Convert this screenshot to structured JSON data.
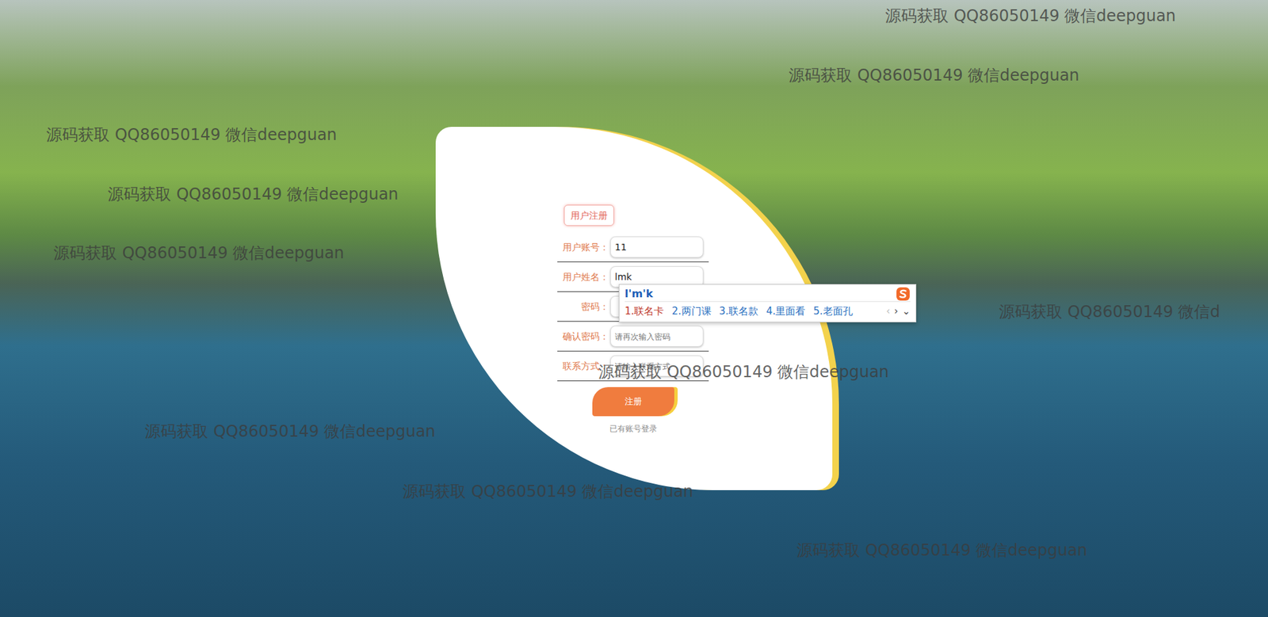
{
  "form": {
    "title": "用户注册",
    "fields": [
      {
        "label": "用户账号：",
        "value": "11"
      },
      {
        "label": "用户姓名：",
        "value": "lmk"
      },
      {
        "label": "密码："
      },
      {
        "label": "确认密码：",
        "placeholder": "请再次输入密码"
      },
      {
        "label": "联系方式：",
        "placeholder": "请输入联系方式"
      }
    ],
    "submit": "注册",
    "login_link": "已有账号登录"
  },
  "ime": {
    "composition": "l'm'k",
    "candidates": [
      {
        "text": "1.联名卡",
        "selected": true
      },
      {
        "text": "2.两门课",
        "selected": false
      },
      {
        "text": "3.联名款",
        "selected": false
      },
      {
        "text": "4.里面看",
        "selected": false
      },
      {
        "text": "5.老面孔",
        "selected": false
      }
    ],
    "prev": "‹",
    "next": "›",
    "expand": "⌄"
  },
  "watermarks": [
    "源码获取 QQ86050149 微信deepguan",
    "源码获取 QQ86050149 微信deepguan",
    "源码获取 QQ86050149 微信deepguan",
    "源码获取 QQ86050149 微信deepguan",
    "源码获取 QQ86050149 微信deepguan",
    "源码获取 QQ86050149 微信d",
    "源码获取 QQ86050149 微信deepguan",
    "源码获取 QQ86050149 微信deepguan",
    "源码获取 QQ86050149 微信deepguan",
    "源码获取 QQ86050149 微信deepguan"
  ]
}
